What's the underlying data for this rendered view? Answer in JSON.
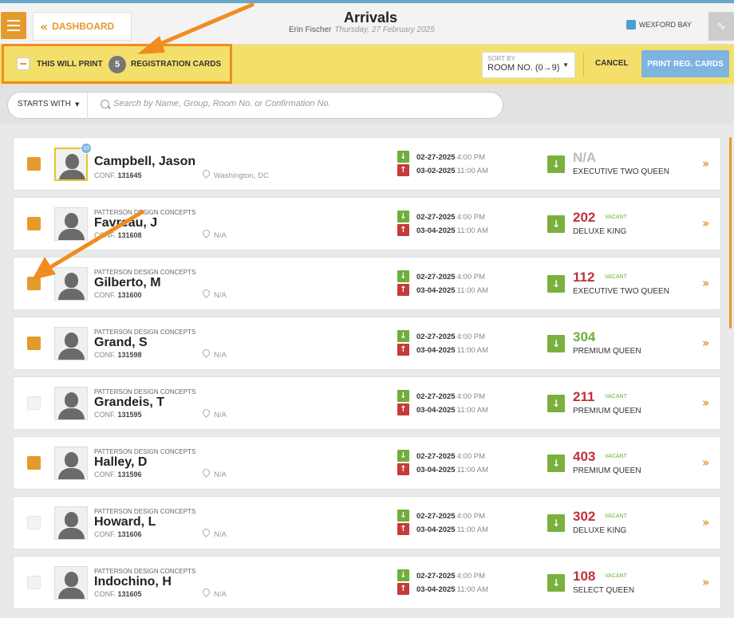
{
  "header": {
    "dashboard_label": "DASHBOARD",
    "title": "Arrivals",
    "user": "Erin Fischer",
    "date": "Thursday, 27 February 2025",
    "brand": "WEXFORD BAY"
  },
  "printbar": {
    "label_before": "THIS WILL PRINT",
    "count": "5",
    "label_after": "REGISTRATION CARDS",
    "sort_label": "SORT BY",
    "sort_value": "ROOM NO. (0→9)",
    "cancel_label": "CANCEL",
    "print_label": "PRINT REG. CARDS"
  },
  "search": {
    "filter_label": "STARTS WITH",
    "placeholder": "Search by Name, Group, Room No. or Confirmation No."
  },
  "conf_prefix": "CONF.",
  "vacant_label": "VACANT",
  "rows": [
    {
      "checked": true,
      "vip": "33",
      "company": "",
      "name": "Campbell, Jason",
      "conf": "131645",
      "location": "Washington, DC",
      "arrive_date": "02-27-2025",
      "arrive_time": "4:00 PM",
      "depart_date": "03-02-2025",
      "depart_time": "11:00 AM",
      "room": "N/A",
      "room_status": "gray",
      "vacant": false,
      "room_type": "EXECUTIVE TWO QUEEN"
    },
    {
      "checked": true,
      "vip": "",
      "company": "PATTERSON DESIGN CONCEPTS",
      "name": "Favreau, J",
      "conf": "131608",
      "location": "N/A",
      "arrive_date": "02-27-2025",
      "arrive_time": "4:00 PM",
      "depart_date": "03-04-2025",
      "depart_time": "11:00 AM",
      "room": "202",
      "room_status": "red",
      "vacant": true,
      "room_type": "DELUXE KING"
    },
    {
      "checked": true,
      "vip": "",
      "company": "PATTERSON DESIGN CONCEPTS",
      "name": "Gilberto, M",
      "conf": "131600",
      "location": "N/A",
      "arrive_date": "02-27-2025",
      "arrive_time": "4:00 PM",
      "depart_date": "03-04-2025",
      "depart_time": "11:00 AM",
      "room": "112",
      "room_status": "red",
      "vacant": true,
      "room_type": "EXECUTIVE TWO QUEEN"
    },
    {
      "checked": true,
      "vip": "",
      "company": "PATTERSON DESIGN CONCEPTS",
      "name": "Grand, S",
      "conf": "131598",
      "location": "N/A",
      "arrive_date": "02-27-2025",
      "arrive_time": "4:00 PM",
      "depart_date": "03-04-2025",
      "depart_time": "11:00 AM",
      "room": "304",
      "room_status": "green",
      "vacant": false,
      "room_type": "PREMIUM QUEEN"
    },
    {
      "checked": false,
      "vip": "",
      "company": "PATTERSON DESIGN CONCEPTS",
      "name": "Grandeis, T",
      "conf": "131595",
      "location": "N/A",
      "arrive_date": "02-27-2025",
      "arrive_time": "4:00 PM",
      "depart_date": "03-04-2025",
      "depart_time": "11:00 AM",
      "room": "211",
      "room_status": "red",
      "vacant": true,
      "room_type": "PREMIUM QUEEN"
    },
    {
      "checked": true,
      "vip": "",
      "company": "PATTERSON DESIGN CONCEPTS",
      "name": "Halley, D",
      "conf": "131596",
      "location": "N/A",
      "arrive_date": "02-27-2025",
      "arrive_time": "4:00 PM",
      "depart_date": "03-04-2025",
      "depart_time": "11:00 AM",
      "room": "403",
      "room_status": "red",
      "vacant": true,
      "room_type": "PREMIUM QUEEN"
    },
    {
      "checked": false,
      "vip": "",
      "company": "PATTERSON DESIGN CONCEPTS",
      "name": "Howard, L",
      "conf": "131606",
      "location": "N/A",
      "arrive_date": "02-27-2025",
      "arrive_time": "4:00 PM",
      "depart_date": "03-04-2025",
      "depart_time": "11:00 AM",
      "room": "302",
      "room_status": "red",
      "vacant": true,
      "room_type": "DELUXE KING"
    },
    {
      "checked": false,
      "vip": "",
      "company": "PATTERSON DESIGN CONCEPTS",
      "name": "Indochino, H",
      "conf": "131605",
      "location": "N/A",
      "arrive_date": "02-27-2025",
      "arrive_time": "4:00 PM",
      "depart_date": "03-04-2025",
      "depart_time": "11:00 AM",
      "room": "108",
      "room_status": "red",
      "vacant": true,
      "room_type": "SELECT QUEEN"
    }
  ]
}
